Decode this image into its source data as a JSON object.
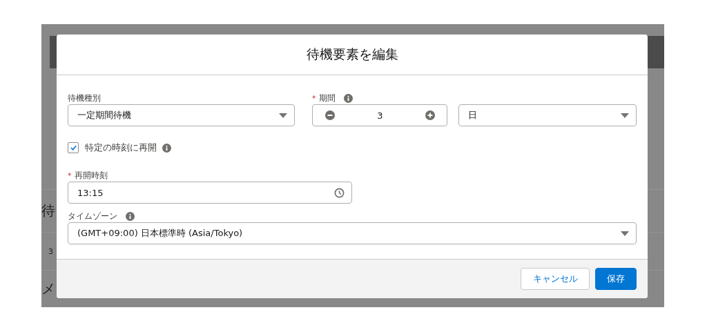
{
  "background": {
    "texts": [
      "待",
      "3",
      "メ"
    ]
  },
  "modal": {
    "title": "待機要素を編集",
    "wait_type": {
      "label": "待機種別",
      "value": "一定期間待機"
    },
    "period": {
      "required_mark": "*",
      "label": "期間",
      "value": "3",
      "unit": "日"
    },
    "resume_at_time": {
      "label": "特定の時刻に再開",
      "checked": true
    },
    "resume_time": {
      "required_mark": "*",
      "label": "再開時刻",
      "value": "13:15"
    },
    "timezone": {
      "label": "タイムゾーン",
      "value": "(GMT+09:00) 日本標準時 (Asia/Tokyo)"
    },
    "buttons": [
      {
        "label": "キャンセル",
        "kind": "neutral"
      },
      {
        "label": "保存",
        "kind": "brand"
      }
    ]
  }
}
